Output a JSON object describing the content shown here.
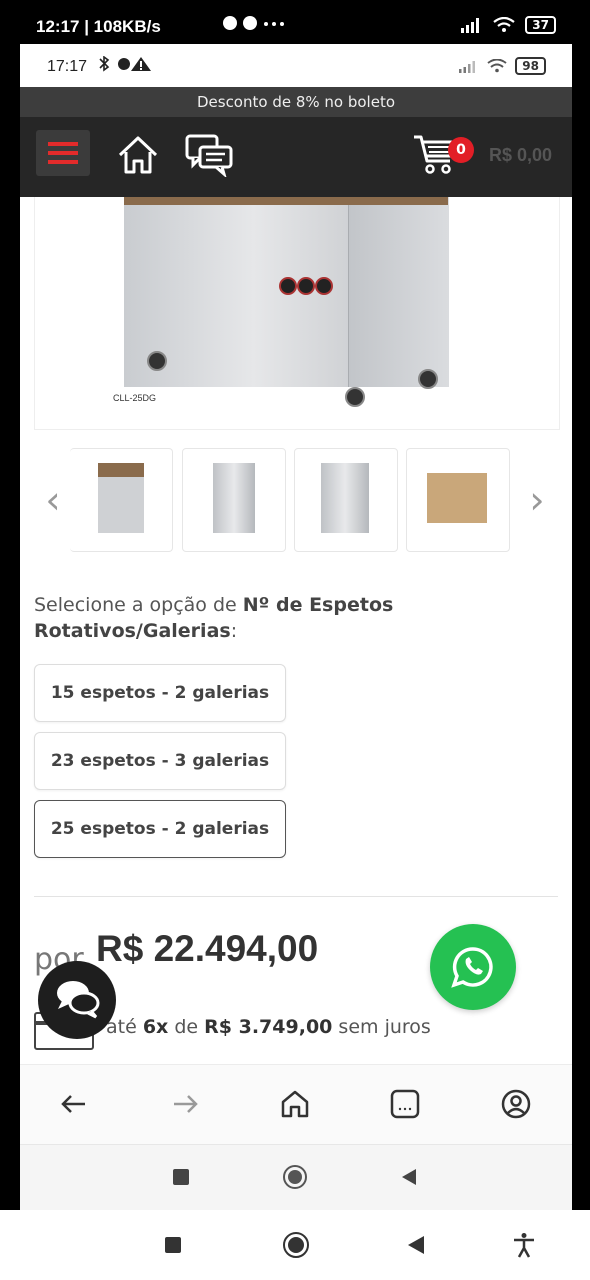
{
  "outer_status": {
    "time": "12:17 | 108KB/s",
    "battery": "37"
  },
  "inner_status": {
    "time": "17:17",
    "battery": "98"
  },
  "promo_banner": "Desconto de 8% no boleto",
  "header": {
    "cart_count": "0",
    "cart_total": "R$ 0,00",
    "accent_color": "#e21e26"
  },
  "product_image": {
    "model_label": "CLL-25DG"
  },
  "option_section": {
    "prefix": "Selecione a opção de ",
    "name": "Nº de Espetos Rotativos/Galerias",
    "suffix": ":",
    "options": [
      {
        "label": "15 espetos - 2 galerias",
        "selected": false
      },
      {
        "label": "23 espetos - 3 galerias",
        "selected": false
      },
      {
        "label": "25 espetos - 2 galerias",
        "selected": true
      }
    ]
  },
  "price": {
    "prefix": "por",
    "value": "R$ 22.494,00"
  },
  "installments": {
    "pre": "até ",
    "count": "6x",
    "mid": " de ",
    "amount": "R$ 3.749,00",
    "post": " sem juros"
  },
  "icons": {
    "whatsapp": "whatsapp-icon",
    "chat": "chat-bubble-icon",
    "home": "home-icon",
    "cart": "cart-icon",
    "menu": "hamburger-icon"
  }
}
